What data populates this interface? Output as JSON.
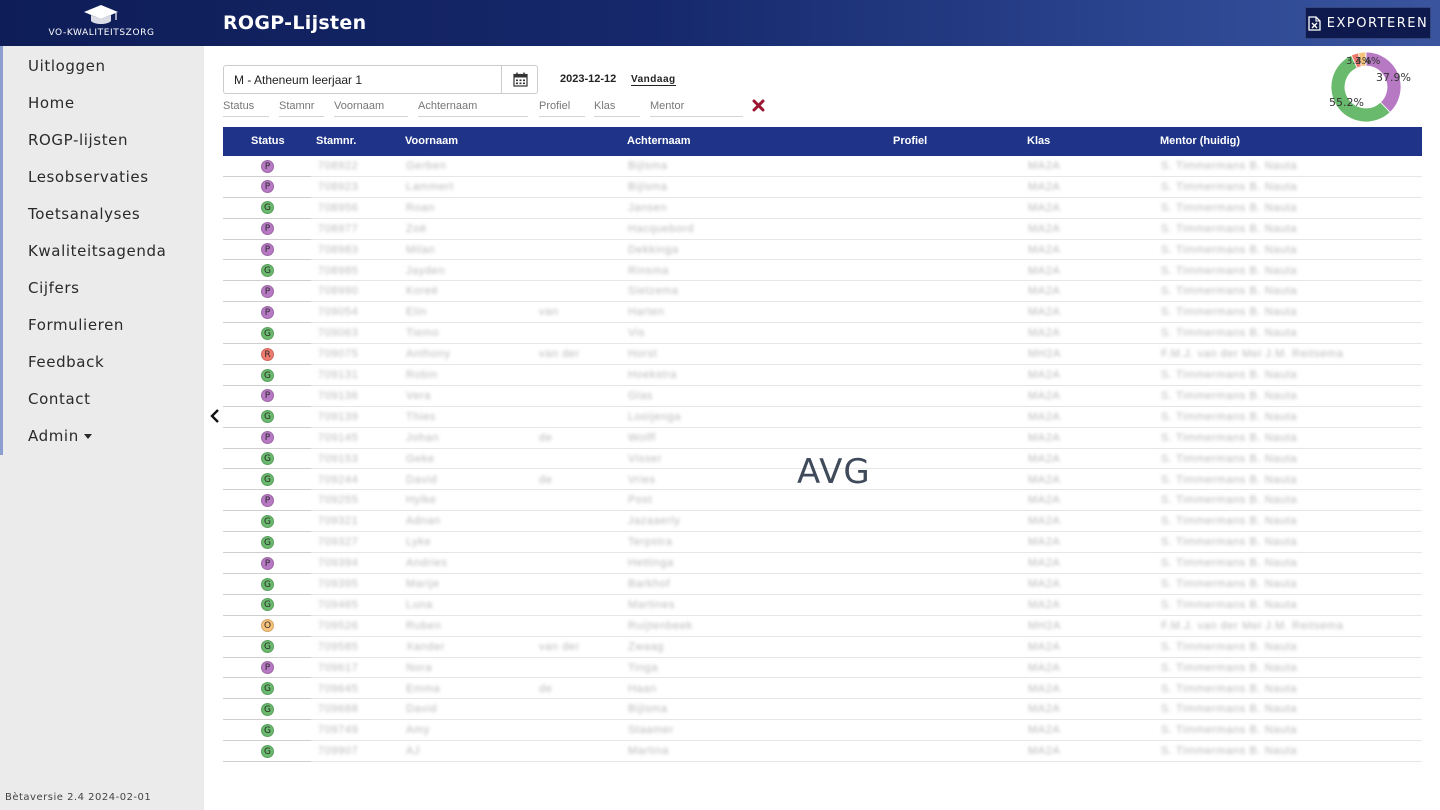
{
  "header": {
    "logo_text": "VO-KWALITEITSZORG",
    "title": "ROGP-Lijsten",
    "export_label": "EXPORTEREN"
  },
  "sidebar": {
    "items": [
      {
        "label": "Uitloggen"
      },
      {
        "label": "Home"
      },
      {
        "label": "ROGP-lijsten"
      },
      {
        "label": "Lesobservaties"
      },
      {
        "label": "Toetsanalyses"
      },
      {
        "label": "Kwaliteitsagenda"
      },
      {
        "label": "Cijfers"
      },
      {
        "label": "Formulieren"
      },
      {
        "label": "Feedback"
      },
      {
        "label": "Contact"
      },
      {
        "label": "Admin"
      }
    ],
    "version": "Bètaversie 2.4 2024-02-01"
  },
  "controls": {
    "class_select_value": "M - Atheneum leerjaar 1",
    "date": "2023-12-12",
    "today_label": "Vandaag",
    "filters": [
      {
        "placeholder": "Status"
      },
      {
        "placeholder": "Stamnr"
      },
      {
        "placeholder": "Voornaam"
      },
      {
        "placeholder": "Achternaam"
      },
      {
        "placeholder": "Profiel"
      },
      {
        "placeholder": "Klas"
      },
      {
        "placeholder": "Mentor"
      }
    ]
  },
  "donut": {
    "labels": [
      {
        "text": "37.9%"
      },
      {
        "text": "55.2%"
      },
      {
        "text": "3.4%"
      },
      {
        "text": "3.4%"
      }
    ],
    "segments": [
      {
        "status": "P",
        "fraction": 0.379,
        "color": "#b779c4"
      },
      {
        "status": "G",
        "fraction": 0.552,
        "color": "#6aba6e"
      },
      {
        "status": "R",
        "fraction": 0.034,
        "color": "#ef7b6f"
      },
      {
        "status": "O",
        "fraction": 0.034,
        "color": "#f7c27a"
      }
    ]
  },
  "table": {
    "headers": [
      "Status",
      "Stamnr.",
      "Voornaam",
      "Achternaam",
      "Profiel",
      "Klas",
      "Mentor (huidig)"
    ],
    "status_colors": {
      "P": "#b779c4",
      "G": "#6aba6e",
      "R": "#ef7b6f",
      "O": "#f7c27a"
    },
    "rows": [
      {
        "status": "P",
        "stamnr": "708922",
        "voornaam": "Gerben",
        "tussenvoegsel": "",
        "achternaam": "Bijlsma",
        "profiel": "",
        "klas": "MA2A",
        "mentor": "S. Timmermans B. Nauta"
      },
      {
        "status": "P",
        "stamnr": "708923",
        "voornaam": "Lammert",
        "tussenvoegsel": "",
        "achternaam": "Bijlsma",
        "profiel": "",
        "klas": "MA2A",
        "mentor": "S. Timmermans B. Nauta"
      },
      {
        "status": "G",
        "stamnr": "708956",
        "voornaam": "Roan",
        "tussenvoegsel": "",
        "achternaam": "Jansen",
        "profiel": "",
        "klas": "MA2A",
        "mentor": "S. Timmermans B. Nauta"
      },
      {
        "status": "P",
        "stamnr": "708977",
        "voornaam": "Zoë",
        "tussenvoegsel": "",
        "achternaam": "Hacquebord",
        "profiel": "",
        "klas": "MA2A",
        "mentor": "S. Timmermans B. Nauta"
      },
      {
        "status": "P",
        "stamnr": "708983",
        "voornaam": "Milan",
        "tussenvoegsel": "",
        "achternaam": "Dekkinga",
        "profiel": "",
        "klas": "MA2A",
        "mentor": "S. Timmermans B. Nauta"
      },
      {
        "status": "G",
        "stamnr": "708985",
        "voornaam": "Jayden",
        "tussenvoegsel": "",
        "achternaam": "Rinsma",
        "profiel": "",
        "klas": "MA2A",
        "mentor": "S. Timmermans B. Nauta"
      },
      {
        "status": "P",
        "stamnr": "708990",
        "voornaam": "Koreé",
        "tussenvoegsel": "",
        "achternaam": "Sietzema",
        "profiel": "",
        "klas": "MA2A",
        "mentor": "S. Timmermans B. Nauta"
      },
      {
        "status": "P",
        "stamnr": "709054",
        "voornaam": "Elin",
        "tussenvoegsel": "van",
        "achternaam": "Harten",
        "profiel": "",
        "klas": "MA2A",
        "mentor": "S. Timmermans B. Nauta"
      },
      {
        "status": "G",
        "stamnr": "709063",
        "voornaam": "Tiemo",
        "tussenvoegsel": "",
        "achternaam": "Vis",
        "profiel": "",
        "klas": "MA2A",
        "mentor": "S. Timmermans B. Nauta"
      },
      {
        "status": "R",
        "stamnr": "709075",
        "voornaam": "Anthony",
        "tussenvoegsel": "van der",
        "achternaam": "Horst",
        "profiel": "",
        "klas": "MH2A",
        "mentor": "F.M.J. van der Mei J.M. Reitsema"
      },
      {
        "status": "G",
        "stamnr": "709131",
        "voornaam": "Robin",
        "tussenvoegsel": "",
        "achternaam": "Hoekstra",
        "profiel": "",
        "klas": "MA2A",
        "mentor": "S. Timmermans B. Nauta"
      },
      {
        "status": "P",
        "stamnr": "709136",
        "voornaam": "Vera",
        "tussenvoegsel": "",
        "achternaam": "Glas",
        "profiel": "",
        "klas": "MA2A",
        "mentor": "S. Timmermans B. Nauta"
      },
      {
        "status": "G",
        "stamnr": "709139",
        "voornaam": "Thies",
        "tussenvoegsel": "",
        "achternaam": "Looijenga",
        "profiel": "",
        "klas": "MA2A",
        "mentor": "S. Timmermans B. Nauta"
      },
      {
        "status": "P",
        "stamnr": "709145",
        "voornaam": "Johan",
        "tussenvoegsel": "de",
        "achternaam": "Wolff",
        "profiel": "",
        "klas": "MA2A",
        "mentor": "S. Timmermans B. Nauta"
      },
      {
        "status": "G",
        "stamnr": "709153",
        "voornaam": "Geke",
        "tussenvoegsel": "",
        "achternaam": "Visser",
        "profiel": "",
        "klas": "MA2A",
        "mentor": "S. Timmermans B. Nauta"
      },
      {
        "status": "G",
        "stamnr": "709244",
        "voornaam": "David",
        "tussenvoegsel": "de",
        "achternaam": "Vries",
        "profiel": "",
        "klas": "MA2A",
        "mentor": "S. Timmermans B. Nauta"
      },
      {
        "status": "P",
        "stamnr": "709255",
        "voornaam": "Hylke",
        "tussenvoegsel": "",
        "achternaam": "Post",
        "profiel": "",
        "klas": "MA2A",
        "mentor": "S. Timmermans B. Nauta"
      },
      {
        "status": "G",
        "stamnr": "709321",
        "voornaam": "Adnan",
        "tussenvoegsel": "",
        "achternaam": "Jazaaerly",
        "profiel": "",
        "klas": "MA2A",
        "mentor": "S. Timmermans B. Nauta"
      },
      {
        "status": "G",
        "stamnr": "709327",
        "voornaam": "Lyke",
        "tussenvoegsel": "",
        "achternaam": "Terpstra",
        "profiel": "",
        "klas": "MA2A",
        "mentor": "S. Timmermans B. Nauta"
      },
      {
        "status": "P",
        "stamnr": "709394",
        "voornaam": "Andries",
        "tussenvoegsel": "",
        "achternaam": "Hettinga",
        "profiel": "",
        "klas": "MA2A",
        "mentor": "S. Timmermans B. Nauta"
      },
      {
        "status": "G",
        "stamnr": "709395",
        "voornaam": "Marije",
        "tussenvoegsel": "",
        "achternaam": "Barkhof",
        "profiel": "",
        "klas": "MA2A",
        "mentor": "S. Timmermans B. Nauta"
      },
      {
        "status": "G",
        "stamnr": "709465",
        "voornaam": "Luna",
        "tussenvoegsel": "",
        "achternaam": "Martines",
        "profiel": "",
        "klas": "MA2A",
        "mentor": "S. Timmermans B. Nauta"
      },
      {
        "status": "O",
        "stamnr": "709526",
        "voornaam": "Ruben",
        "tussenvoegsel": "",
        "achternaam": "Ruijtenbeek",
        "profiel": "",
        "klas": "MH2A",
        "mentor": "F.M.J. van der Mei J.M. Reitsema"
      },
      {
        "status": "G",
        "stamnr": "709585",
        "voornaam": "Xander",
        "tussenvoegsel": "van der",
        "achternaam": "Zwaag",
        "profiel": "",
        "klas": "MA2A",
        "mentor": "S. Timmermans B. Nauta"
      },
      {
        "status": "P",
        "stamnr": "709617",
        "voornaam": "Nora",
        "tussenvoegsel": "",
        "achternaam": "Tinga",
        "profiel": "",
        "klas": "MA2A",
        "mentor": "S. Timmermans B. Nauta"
      },
      {
        "status": "G",
        "stamnr": "709645",
        "voornaam": "Emma",
        "tussenvoegsel": "de",
        "achternaam": "Haan",
        "profiel": "",
        "klas": "MA2A",
        "mentor": "S. Timmermans B. Nauta"
      },
      {
        "status": "G",
        "stamnr": "709688",
        "voornaam": "David",
        "tussenvoegsel": "",
        "achternaam": "Bijlsma",
        "profiel": "",
        "klas": "MA2A",
        "mentor": "S. Timmermans B. Nauta"
      },
      {
        "status": "G",
        "stamnr": "709749",
        "voornaam": "Amy",
        "tussenvoegsel": "",
        "achternaam": "Staamer",
        "profiel": "",
        "klas": "MA2A",
        "mentor": "S. Timmermans B. Nauta"
      },
      {
        "status": "G",
        "stamnr": "709907",
        "voornaam": "AJ",
        "tussenvoegsel": "",
        "achternaam": "Martina",
        "profiel": "",
        "klas": "MA2A",
        "mentor": "S. Timmermans B. Nauta"
      }
    ]
  },
  "watermark": "AVG"
}
